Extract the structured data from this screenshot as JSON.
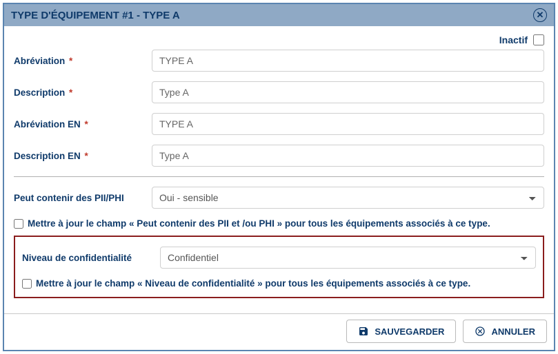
{
  "header": {
    "title": "TYPE D'ÉQUIPEMENT #1 - TYPE A"
  },
  "inactif": {
    "label": "Inactif",
    "checked": false
  },
  "fields": {
    "abrev": {
      "label": "Abréviation",
      "value": "TYPE A"
    },
    "desc": {
      "label": "Description",
      "value": "Type A"
    },
    "abrev_en": {
      "label": "Abréviation EN",
      "value": "TYPE A"
    },
    "desc_en": {
      "label": "Description EN",
      "value": "Type A"
    },
    "pii": {
      "label": "Peut contenir des PII/PHI",
      "value": "Oui - sensible"
    },
    "confid": {
      "label": "Niveau de confidentialité",
      "value": "Confidentiel"
    }
  },
  "checks": {
    "pii_update": "Mettre à jour le champ « Peut contenir des PII et /ou PHI » pour tous les équipements associés à ce type.",
    "confid_update": "Mettre à jour le champ « Niveau de confidentialité » pour tous les équipements associés à ce type."
  },
  "footer": {
    "save": "SAUVEGARDER",
    "cancel": "ANNULER"
  }
}
